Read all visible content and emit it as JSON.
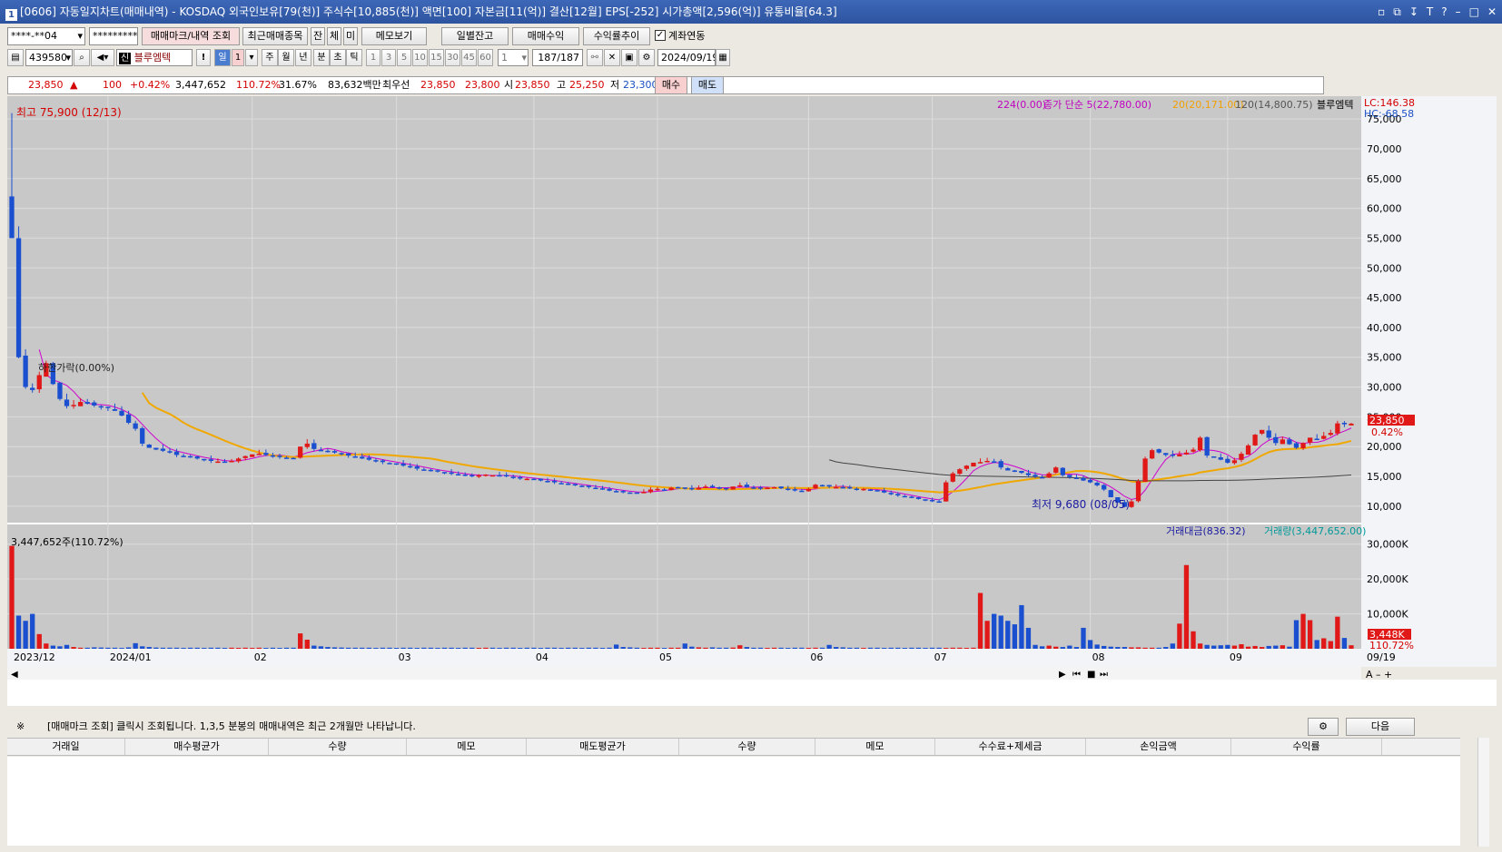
{
  "window": {
    "title": "[0606] 자동일지차트(매매내역) - KOSDAQ 외국인보유[79(천)] 주식수[10,885(천)] 액면[100] 자본금[11(억)] 결산[12월] EPS[-252] 시가총액[2,596(억)] 유통비율[64.3]",
    "icon": "1",
    "buttons": [
      "▫",
      "⧉",
      "↧",
      "T",
      "?",
      "–",
      "□",
      "✕"
    ]
  },
  "toolbar1": {
    "account": "****-**04",
    "password": "*********",
    "buttons": [
      "매매마크/내역 조회",
      "최근매매종목",
      "잔",
      "체",
      "미",
      "메모보기",
      "일별잔고",
      "매매수익",
      "수익률추이"
    ],
    "link_label": "계좌연동",
    "link_checked": true
  },
  "toolbar2": {
    "code": "439580",
    "name": "블루엠텍",
    "badge": "신",
    "exclaim": "!",
    "periods": [
      "일",
      "1",
      "주",
      "월",
      "년",
      "분",
      "초",
      "틱"
    ],
    "minutes": [
      "1",
      "3",
      "5",
      "10",
      "15",
      "30",
      "45",
      "60"
    ],
    "count": "1",
    "range": "187/187",
    "date": "2024/09/19"
  },
  "quote": {
    "price": "23,850",
    "arrow": "▲",
    "change": "100",
    "pct": "+0.42%",
    "volume": "3,447,652",
    "vol_ratio": "110.72%",
    "turnover": "31.67%",
    "amount": "83,632백만",
    "label_best": "최우선",
    "best_ask": "23,850",
    "best_bid": "23,800",
    "open_label": "시",
    "open": "23,850",
    "high_label": "고",
    "high": "25,250",
    "low_label": "저",
    "low": "23,300",
    "buy": "매수",
    "sell": "매도"
  },
  "chart_data": {
    "type": "candlestick",
    "legend_price": {
      "ma224": "224(0.00)",
      "ma5": "종가 단순 5(22,780.00)",
      "ma20": "20(20,171.00)",
      "ma120": "120(14,800.75)",
      "item": "블루엠텍"
    },
    "lc": "LC:146.38",
    "hc": "HC:-68.58",
    "y_ticks": [
      "75,000",
      "70,000",
      "65,000",
      "60,000",
      "55,000",
      "50,000",
      "45,000",
      "40,000",
      "35,000",
      "30,000",
      "25,000",
      "20,000",
      "15,000",
      "10,000"
    ],
    "ylim": [
      8000,
      77000
    ],
    "high_note": "최고 75,900 (12/13)",
    "low_note": "최저 9,680 (08/05)",
    "mark_note": "하한가락(0.00%)",
    "last_price": "23,850",
    "last_pct": "0.42%",
    "closes": [
      55000,
      35000,
      30000,
      29500,
      32000,
      34000,
      30500,
      28000,
      26800,
      27000,
      27500,
      27200,
      26900,
      26600,
      26500,
      26000,
      25200,
      24000,
      23000,
      20500,
      19800,
      19500,
      19300,
      19100,
      18600,
      18400,
      18200,
      18000,
      17800,
      17600,
      17500,
      17400,
      17600,
      18000,
      18400,
      18700,
      18800,
      18600,
      18400,
      18300,
      18100,
      18000,
      20000,
      20500,
      19600,
      19300,
      19100,
      19000,
      18800,
      18500,
      18300,
      18000,
      17800,
      17600,
      17400,
      17200,
      17000,
      16800,
      16600,
      16300,
      16100,
      15900,
      15800,
      15600,
      15500,
      15300,
      15100,
      15000,
      15200,
      15300,
      15200,
      15100,
      15000,
      14800,
      14700,
      14600,
      14500,
      14300,
      14200,
      14000,
      13800,
      13600,
      13500,
      13400,
      13200,
      13000,
      12800,
      12600,
      12500,
      12400,
      12300,
      12200,
      12400,
      12800,
      12900,
      12700,
      13100,
      13200,
      13000,
      12900,
      13100,
      13300,
      13200,
      13000,
      12900,
      13300,
      13500,
      13200,
      13100,
      13000,
      13100,
      13200,
      13000,
      12800,
      12700,
      12500,
      12900,
      13600,
      13500,
      13300,
      13200,
      13100,
      13000,
      12800,
      12900,
      12700,
      12500,
      12300,
      12000,
      11800,
      11600,
      11400,
      11200,
      11000,
      10900,
      10800,
      14000,
      15500,
      16200,
      16800,
      17300,
      17400,
      17600,
      17500,
      16500,
      16000,
      15800,
      15600,
      15200,
      15000,
      14800,
      15500,
      16500,
      15200,
      14900,
      14700,
      14300,
      14000,
      13500,
      12800,
      11500,
      10600,
      9900,
      10800,
      14200,
      18000,
      19400,
      19000,
      18600,
      18500,
      18700,
      19000,
      19500,
      21500,
      18500,
      18200,
      17800,
      17300,
      17700,
      18800,
      20200,
      22000,
      22800,
      21500,
      20600,
      21200,
      20400,
      19800,
      20600,
      21500,
      21300,
      21800,
      22300,
      23900,
      23750,
      23850
    ],
    "volume_legend": {
      "amount": "거래대금(836.32)",
      "volume": "거래량(3,447,652.00)"
    },
    "volume_note": "3,447,652주(110.72%)",
    "volume_ticks": [
      "30,000K",
      "20,000K",
      "10,000K"
    ],
    "volume_last": "3,448K",
    "volume_last_pct": "110.72%",
    "volumes": [
      29500,
      9500,
      8000,
      10000,
      4200,
      1500,
      900,
      700,
      1100,
      500,
      300,
      300,
      400,
      350,
      300,
      300,
      250,
      400,
      1600,
      700,
      500,
      350,
      300,
      300,
      300,
      250,
      300,
      300,
      250,
      300,
      300,
      250,
      300,
      250,
      300,
      250,
      300,
      250,
      300,
      250,
      300,
      300,
      4400,
      2600,
      900,
      700,
      500,
      400,
      350,
      300,
      300,
      300,
      300,
      250,
      300,
      300,
      250,
      300,
      300,
      250,
      300,
      300,
      250,
      300,
      300,
      250,
      300,
      300,
      250,
      300,
      300,
      250,
      300,
      300,
      250,
      300,
      300,
      250,
      300,
      300,
      250,
      300,
      300,
      250,
      300,
      300,
      250,
      300,
      1200,
      500,
      400,
      300,
      250,
      300,
      300,
      250,
      300,
      300,
      1500,
      600,
      400,
      300,
      400,
      300,
      300,
      350,
      1000,
      500,
      300,
      300,
      250,
      300,
      300,
      250,
      300,
      300,
      250,
      300,
      300,
      1100,
      500,
      400,
      300,
      300,
      250,
      300,
      300,
      250,
      300,
      300,
      250,
      300,
      300,
      250,
      300,
      300,
      250,
      300,
      300,
      250,
      300,
      16000,
      8000,
      10000,
      9500,
      8000,
      7000,
      12500,
      6000,
      1100,
      700,
      900,
      600,
      500,
      900,
      500,
      6000,
      2500,
      1200,
      800,
      600,
      500,
      500,
      400,
      400,
      300,
      300,
      300,
      500,
      1500,
      7200,
      24000,
      5000,
      1500,
      1100,
      900,
      1000,
      1100,
      900,
      1300,
      600,
      800,
      500,
      800,
      900,
      1000,
      600,
      8200,
      10000,
      8200,
      2500,
      3000,
      2200,
      9200,
      3100,
      1000,
      1500,
      13000,
      2700,
      3448
    ],
    "x_labels": [
      "2023/12",
      "2024/01",
      "02",
      "03",
      "04",
      "05",
      "06",
      "07",
      "08",
      "09",
      "09/19"
    ]
  },
  "bottom": {
    "note_mark": "※",
    "note": "[매매마크 조회] 클릭시 조회됩니다. 1,3,5 분봉의 매매내역은 최근 2개월만 나타납니다.",
    "next": "다음"
  },
  "table": {
    "columns": [
      "거래일",
      "매수평균가",
      "수량",
      "메모",
      "매도평균가",
      "수량",
      "메모",
      "수수료+제세금",
      "손익금액",
      "수익률"
    ]
  }
}
